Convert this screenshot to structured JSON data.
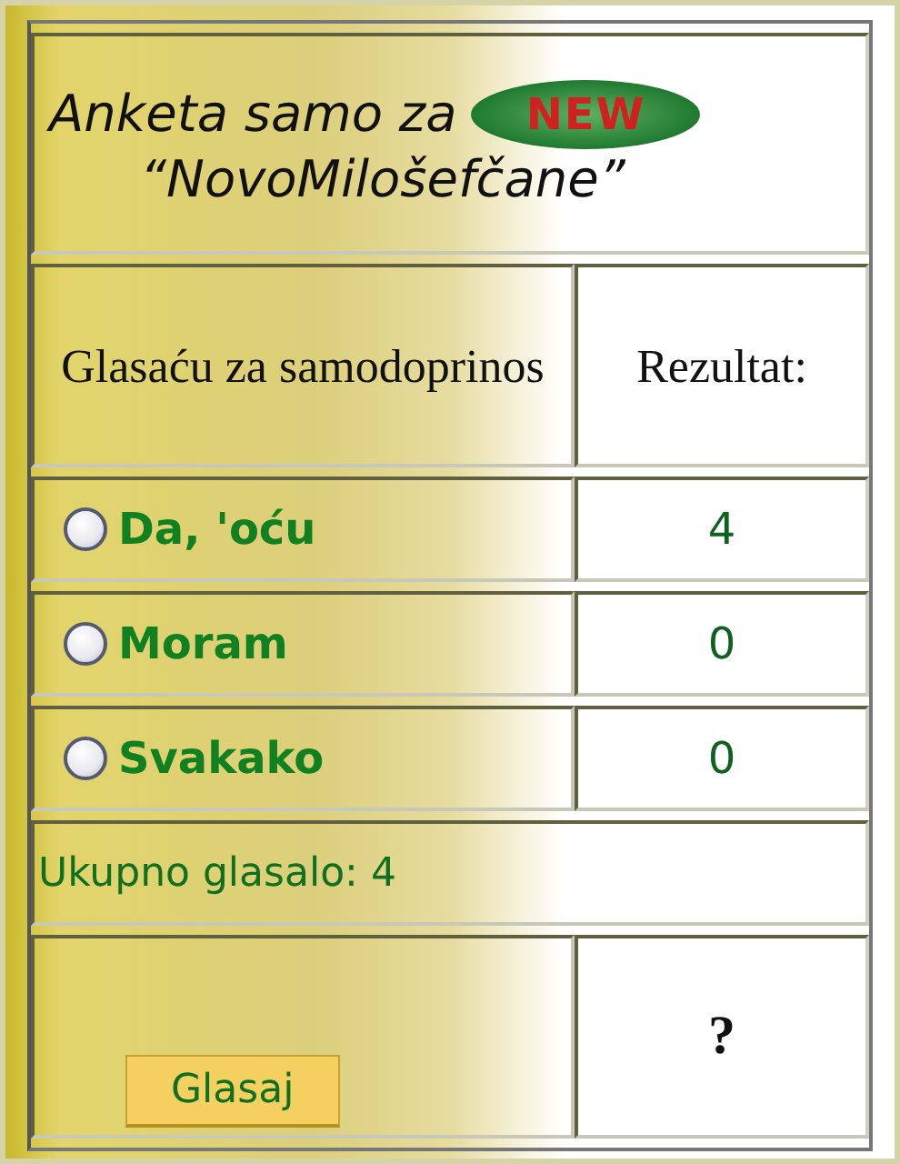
{
  "poll": {
    "title_line_1": "Anketa samo za",
    "title_line_2": "“NovoMilošefčane”",
    "badge": "NEW",
    "question": "Glasaću za samodoprinos",
    "results_header": "Rezultat:",
    "options": [
      {
        "label": "Da, 'oću",
        "selected": false,
        "count": "4"
      },
      {
        "label": "Moram",
        "selected": false,
        "count": "0"
      },
      {
        "label": "Svakako",
        "selected": false,
        "count": "0"
      }
    ],
    "total": "Ukupno glasalo: 4",
    "vote_button": "Glasaj",
    "result_mark": "?"
  }
}
